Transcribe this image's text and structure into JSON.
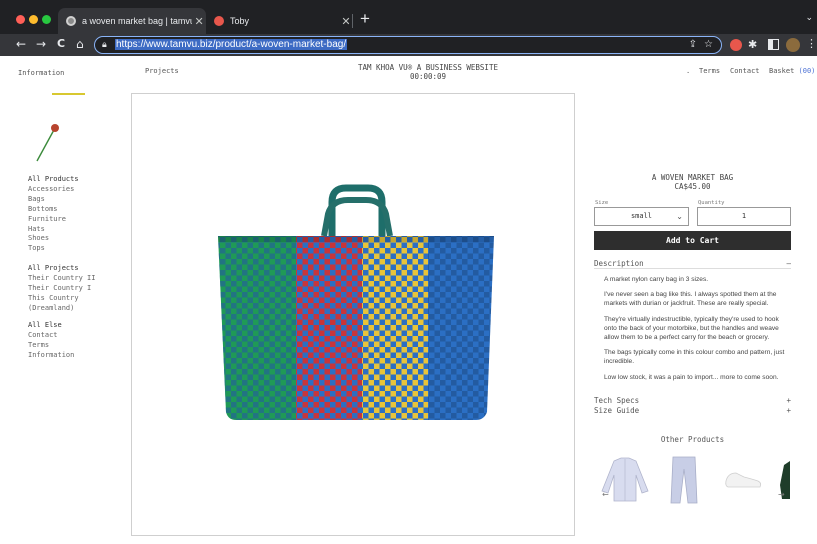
{
  "browser": {
    "tabs": [
      {
        "title": "a woven market bag | tamvu.biz",
        "close": "✕",
        "active": true
      },
      {
        "title": "Toby",
        "close": "✕",
        "active": false
      }
    ],
    "new_tab": "+",
    "tab_menu": "⌄",
    "url": "https://www.tamvu.biz/product/a-woven-market-bag/",
    "nav": {
      "back": "←",
      "forward": "→",
      "reload": "C",
      "home": "⌂"
    }
  },
  "header": {
    "information": "Information",
    "projects": "Projects",
    "site_title_line1": "TAM KHOA VU® A BUSINESS WEBSITE",
    "clock": "00:00:09",
    "dot": ".",
    "terms": "Terms",
    "contact": "Contact",
    "basket": "Basket",
    "basket_count": "(00)"
  },
  "sidebar": {
    "products": {
      "title": "All Products",
      "items": [
        "Accessories",
        "Bags",
        "Bottoms",
        "Furniture",
        "Hats",
        "Shoes",
        "Tops"
      ]
    },
    "projects": {
      "title": "All Projects",
      "items": [
        "Their Country II",
        "Their Country I",
        "This Country",
        "(Dreamland)"
      ]
    },
    "else": {
      "title": "All Else",
      "items": [
        "Contact",
        "Terms",
        "Information"
      ]
    }
  },
  "product": {
    "name": "A WOVEN MARKET BAG",
    "price": "CA$45.00",
    "size_label": "Size",
    "size_value": "small",
    "quantity_label": "Quantity",
    "quantity_value": "1",
    "add_to_cart": "Add to Cart",
    "description_title": "Description",
    "description_sign": "–",
    "description": [
      "A market nylon carry bag in 3 sizes.",
      "I've never seen a bag like this. I always spotted them at the markets with durian or jackfruit. These are really special.",
      "They're virtually indestructible, typically they're used to hook onto the back of your motorbike, but the handles and weave allow them to be a perfect carry for the beach or grocery.",
      "The bags typically come in this colour combo and pattern, just incredible.",
      "Low low stock, it was a pain to import... more to come soon."
    ],
    "tech_specs": "Tech Specs",
    "size_guide": "Size Guide",
    "plus": "+",
    "other_products": "Other Products",
    "carousel_prev": "←",
    "carousel_next": "→"
  },
  "colors": {
    "bag_green": "#1f9a56",
    "bag_blue": "#2b6fc4",
    "bag_red": "#c8353a",
    "bag_yellow": "#e8c43a",
    "handle": "#1e6e6a",
    "accent_link": "#4a6fd4"
  }
}
